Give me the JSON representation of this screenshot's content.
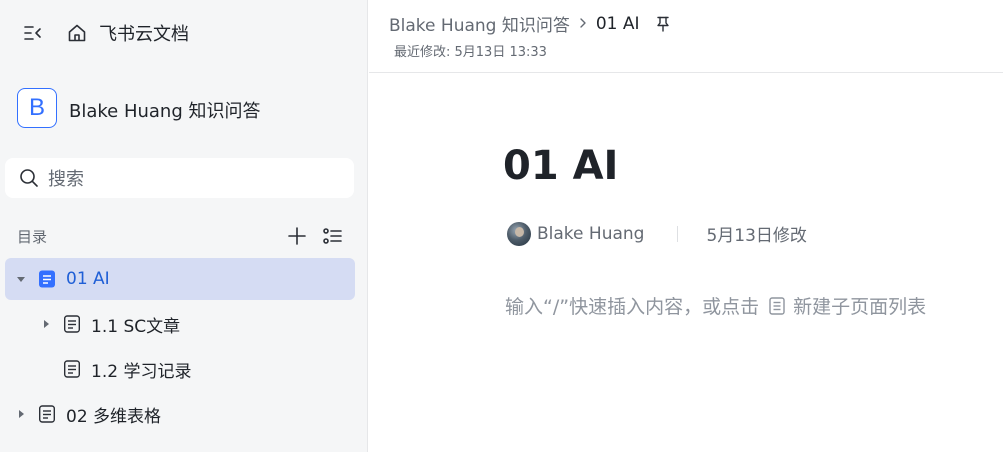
{
  "sidebar": {
    "app_name": "飞书云文档",
    "space": {
      "avatar_letter": "B",
      "name": "Blake Huang 知识问答"
    },
    "search": {
      "placeholder": "搜索"
    },
    "catalog": {
      "title": "目录"
    },
    "tree": [
      {
        "label": "01 AI",
        "expanded": true,
        "selected": true
      },
      {
        "label": "1.1 SC文章",
        "expanded": false,
        "selected": false
      },
      {
        "label": "1.2 学习记录",
        "expanded": false,
        "selected": false
      },
      {
        "label": "02 多维表格",
        "expanded": false,
        "selected": false
      }
    ]
  },
  "header": {
    "breadcrumb_root": "Blake Huang 知识问答",
    "breadcrumb_separator": ">",
    "breadcrumb_current": "01 AI",
    "last_modified": "最近修改: 5月13日 13:33"
  },
  "document": {
    "title": "01 AI",
    "author": "Blake Huang",
    "modified": "5月13日修改",
    "hint_prefix": "输入“/”快速插入内容，或点击",
    "hint_link": "新建子页面列表"
  },
  "colors": {
    "accent": "#3370ff",
    "selected_bg": "#d5dcf3",
    "selected_text": "#1f5fd6",
    "sidebar_bg": "#f5f6f7"
  },
  "icons": [
    "sidebar-collapse-icon",
    "home-icon",
    "search-icon",
    "plus-icon",
    "outline-list-icon",
    "caret-down-icon",
    "caret-right-icon",
    "document-icon",
    "pin-icon",
    "subpage-list-icon"
  ]
}
